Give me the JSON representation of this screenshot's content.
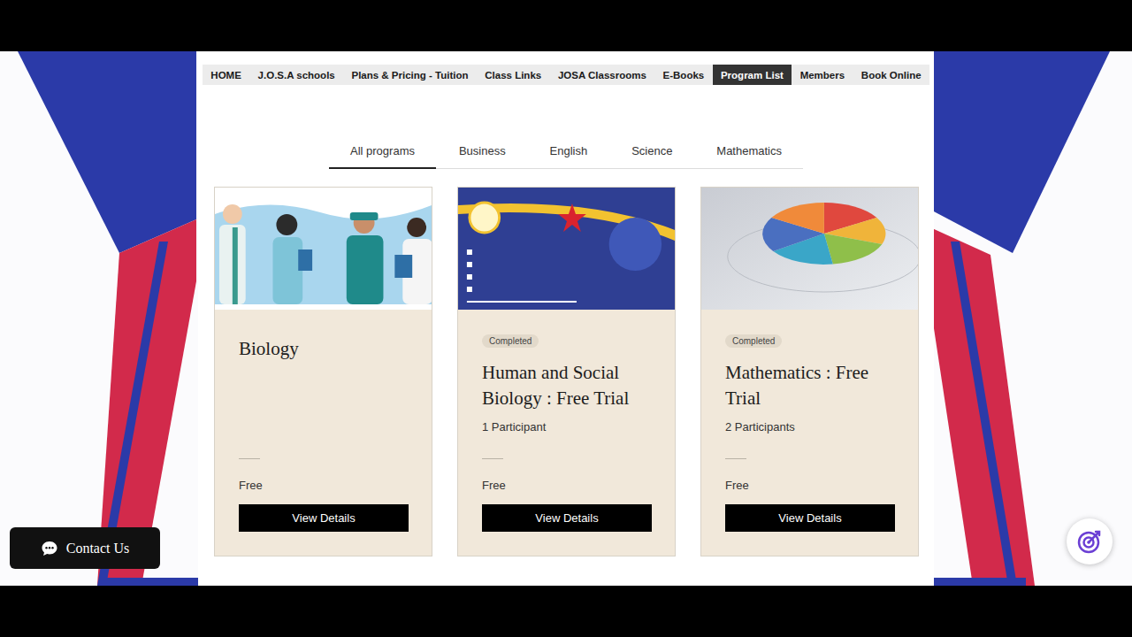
{
  "nav": [
    {
      "label": "HOME",
      "selected": false
    },
    {
      "label": "J.O.S.A schools",
      "selected": false
    },
    {
      "label": "Plans & Pricing - Tuition",
      "selected": false
    },
    {
      "label": "Class Links",
      "selected": false
    },
    {
      "label": "JOSA Classrooms",
      "selected": false
    },
    {
      "label": "E-Books",
      "selected": false
    },
    {
      "label": "Program List",
      "selected": true
    },
    {
      "label": "Members",
      "selected": false
    },
    {
      "label": "Book Online",
      "selected": false
    }
  ],
  "tabs": [
    {
      "label": "All programs",
      "selected": true
    },
    {
      "label": "Business",
      "selected": false
    },
    {
      "label": "English",
      "selected": false
    },
    {
      "label": "Science",
      "selected": false
    },
    {
      "label": "Mathematics",
      "selected": false
    }
  ],
  "programs": [
    {
      "kind": "doctors",
      "title": "Biology",
      "price": "Free",
      "button": "View Details"
    },
    {
      "kind": "promo",
      "badge": "Completed",
      "title": "Human and Social Biology : Free Trial",
      "participants": "1 Participant",
      "price": "Free",
      "button": "View Details"
    },
    {
      "kind": "chart",
      "badge": "Completed",
      "title": "Mathematics : Free Trial",
      "participants": "2 Participants",
      "price": "Free",
      "button": "View Details"
    }
  ],
  "contact": {
    "label": "Contact Us"
  }
}
